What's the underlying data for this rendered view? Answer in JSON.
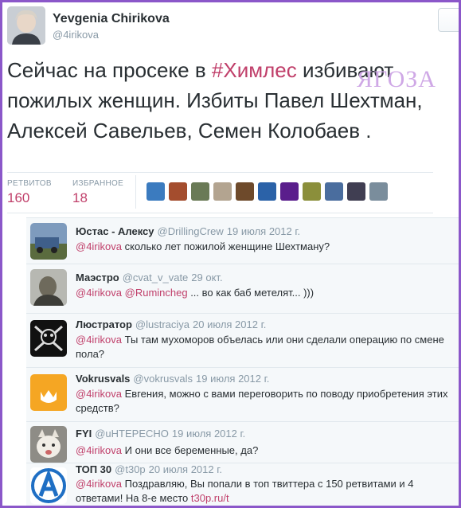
{
  "tweet": {
    "author_name": "Yevgenia Chirikova",
    "author_handle": "@4irikova",
    "text_before": "Сейчас на просеке в ",
    "hashtag": "#Химлес",
    "text_after": " избивают пожилых женщин. Избиты Павел Шехтман, Алексей Савельев, Семен Колобаев .",
    "watermark": "ЯГОЗА"
  },
  "stats": {
    "retweets_label": "РЕТВИТОВ",
    "retweets_value": "160",
    "favorites_label": "ИЗБРАННОЕ",
    "favorites_value": "18"
  },
  "favoriters": [
    {
      "color": "#3b7bbf"
    },
    {
      "color": "#a44d2e"
    },
    {
      "color": "#6a7a56"
    },
    {
      "color": "#b3a490"
    },
    {
      "color": "#6e4a2b"
    },
    {
      "color": "#2b62a8"
    },
    {
      "color": "#5a1e8c"
    },
    {
      "color": "#8b8f3b"
    },
    {
      "color": "#4a6d9e"
    },
    {
      "color": "#403e52"
    },
    {
      "color": "#7a8d9c"
    }
  ],
  "replies": [
    {
      "name": "Юстас - Алексу",
      "handle": "@DrillingCrew",
      "time": "19 июля 2012 г.",
      "mention": "@4irikova",
      "text": " сколько лет пожилой женщине Шехтману?",
      "avatar_color": "#6b87a8"
    },
    {
      "name": "Маэстро",
      "handle": "@cvat_v_vate",
      "time": "29 окт.",
      "mention": "@4irikova",
      "mention2": "@Rumincheg",
      "text": " ... во как баб  метелят...  )))",
      "avatar_color": "#8c8e86"
    },
    {
      "name": "Люстратор",
      "handle": "@lustraciya",
      "time": "20 июля 2012 г.",
      "mention": "@4irikova",
      "text": " Ты там мухоморов объелась или они сделали операцию по смене пола?",
      "avatar_color": "#111111"
    },
    {
      "name": "Vokrusvals",
      "handle": "@vokrusvals",
      "time": "19 июля 2012 г.",
      "mention": "@4irikova",
      "text": " Евгения, можно с вами переговорить по поводу приобретения этих средств?",
      "avatar_color": "#f5a623"
    },
    {
      "name": "FYI",
      "handle": "@uHTEPECHO",
      "time": "19 июля 2012 г.",
      "mention": "@4irikova",
      "text": " И они все беременные, да?",
      "avatar_color": "#9d9c98"
    },
    {
      "name": "ТОП 30",
      "handle": "@t30p",
      "time": "20 июля 2012 г.",
      "mention": "@4irikova",
      "text": " Поздравляю, Вы попали в топ твиттера с 150 ретвитами и 4 ответами! На 8-е место ",
      "link": "t30p.ru/t",
      "avatar_color": "#ffffff"
    }
  ]
}
